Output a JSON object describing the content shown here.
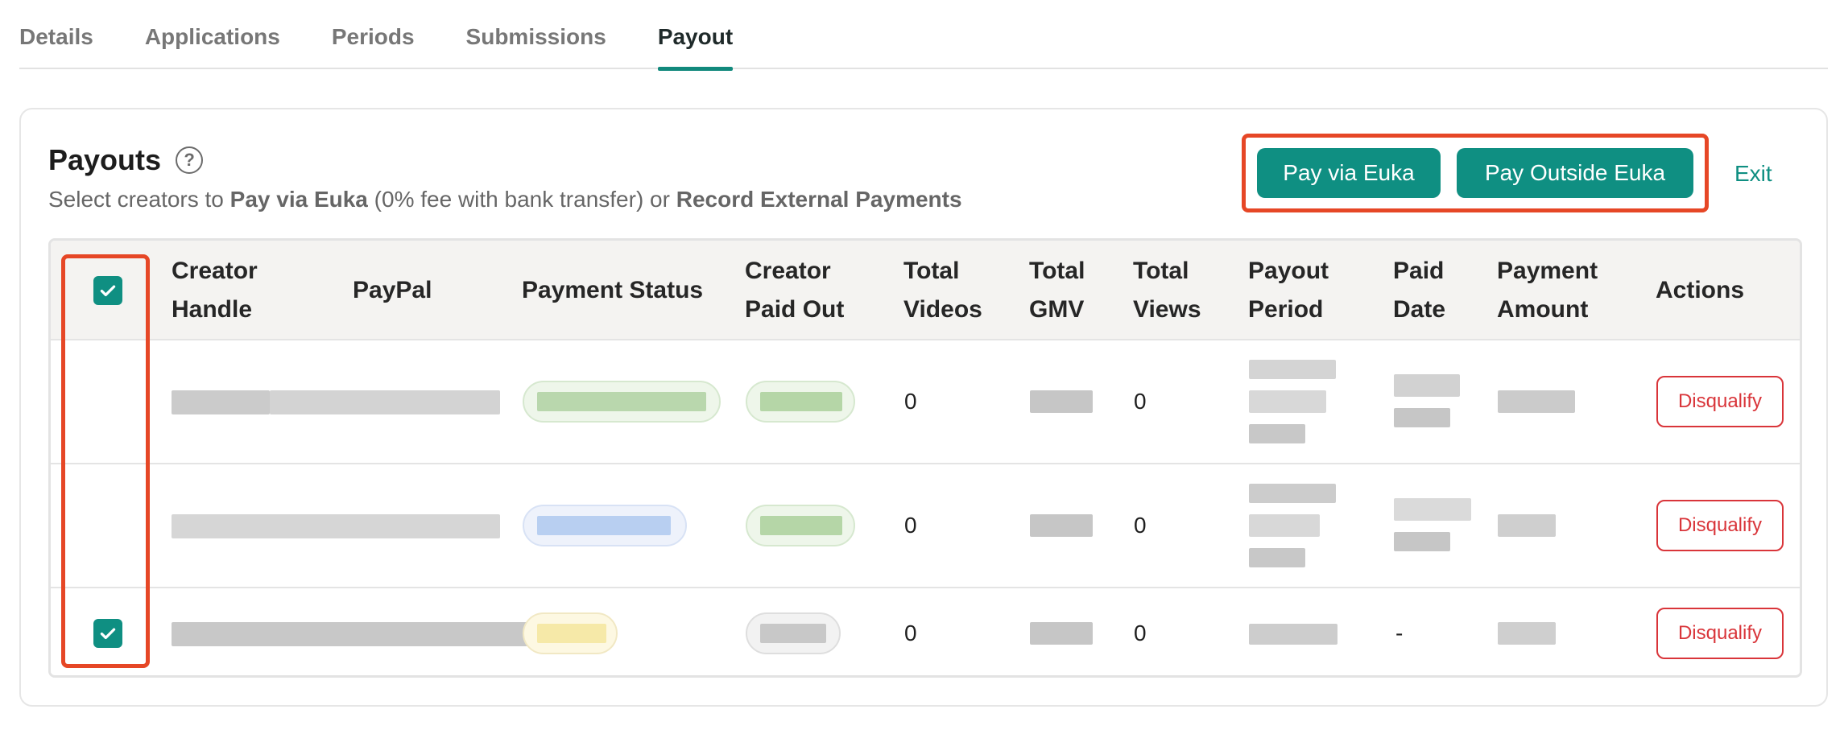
{
  "tabs": [
    {
      "label": "Details",
      "active": false
    },
    {
      "label": "Applications",
      "active": false
    },
    {
      "label": "Periods",
      "active": false
    },
    {
      "label": "Submissions",
      "active": false
    },
    {
      "label": "Payout",
      "active": true
    }
  ],
  "card": {
    "title": "Payouts",
    "help_icon": "?",
    "subtitle": {
      "prefix": "Select creators to ",
      "pay_via": "Pay via Euka",
      "middle": " (0% fee with bank transfer) or ",
      "record": "Record External Payments"
    },
    "buttons": {
      "pay_via_euka": "Pay via Euka",
      "pay_outside_euka": "Pay Outside Euka",
      "exit": "Exit"
    }
  },
  "table": {
    "headers": {
      "creator_handle": [
        "Creator",
        "Handle"
      ],
      "paypal": "PayPal",
      "payment_status": "Payment Status",
      "creator_paid_out": [
        "Creator",
        "Paid Out"
      ],
      "total_videos": [
        "Total",
        "Videos"
      ],
      "total_gmv": [
        "Total",
        "GMV"
      ],
      "total_views": [
        "Total",
        "Views"
      ],
      "payout_period": [
        "Payout",
        "Period"
      ],
      "paid_date": [
        "Paid",
        "Date"
      ],
      "payment_amount": [
        "Payment",
        "Amount"
      ],
      "actions": "Actions"
    },
    "header_checked": true,
    "rows": [
      {
        "checked": false,
        "total_videos": "0",
        "total_views": "0",
        "paid_date": "",
        "action": "Disqualify",
        "status_color": "#b9d7ad",
        "paidout_color": "#b5d6a7"
      },
      {
        "checked": false,
        "total_videos": "0",
        "total_views": "0",
        "paid_date": "",
        "action": "Disqualify",
        "status_color": "#b8cff1",
        "paidout_color": "#b5d6a7"
      },
      {
        "checked": true,
        "total_videos": "0",
        "total_views": "0",
        "paid_date": "-",
        "action": "Disqualify",
        "status_color": "#f6e9a8",
        "paidout_color": "#c8c8c8"
      }
    ]
  },
  "colors": {
    "accent": "#0f8f82",
    "highlight": "#e64726",
    "danger": "#d9353a"
  }
}
